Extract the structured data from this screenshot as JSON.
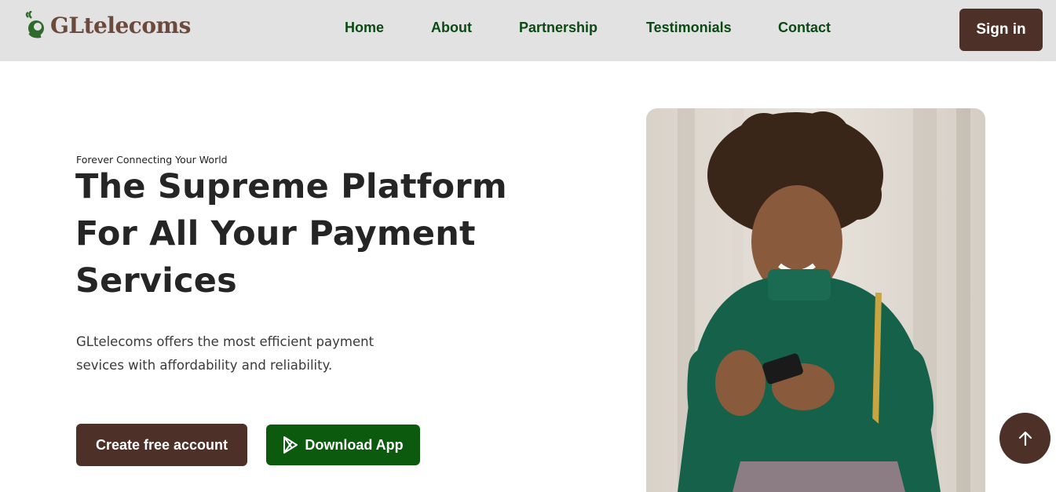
{
  "brand": {
    "name": "GLtelecoms",
    "colors": {
      "primary_brown": "#4d3027",
      "primary_green": "#0b5a0d",
      "nav_text": "#0b4a12",
      "navbar_bg": "#e2e2e2"
    }
  },
  "nav": {
    "links": [
      "Home",
      "About",
      "Partnership",
      "Testimonials",
      "Contact"
    ],
    "signin_label": "Sign in"
  },
  "hero": {
    "tagline": "Forever Connecting Your World",
    "title": "The Supreme Platform For All Your Payment Services",
    "description": "GLtelecoms offers the most efficient payment sevices with affordability and reliability.",
    "create_label": "Create free account",
    "download_label": "Download App",
    "download_icon": "play-store-icon",
    "image": "woman-using-phone-photo"
  },
  "scroll_top_icon": "arrow-up-icon"
}
